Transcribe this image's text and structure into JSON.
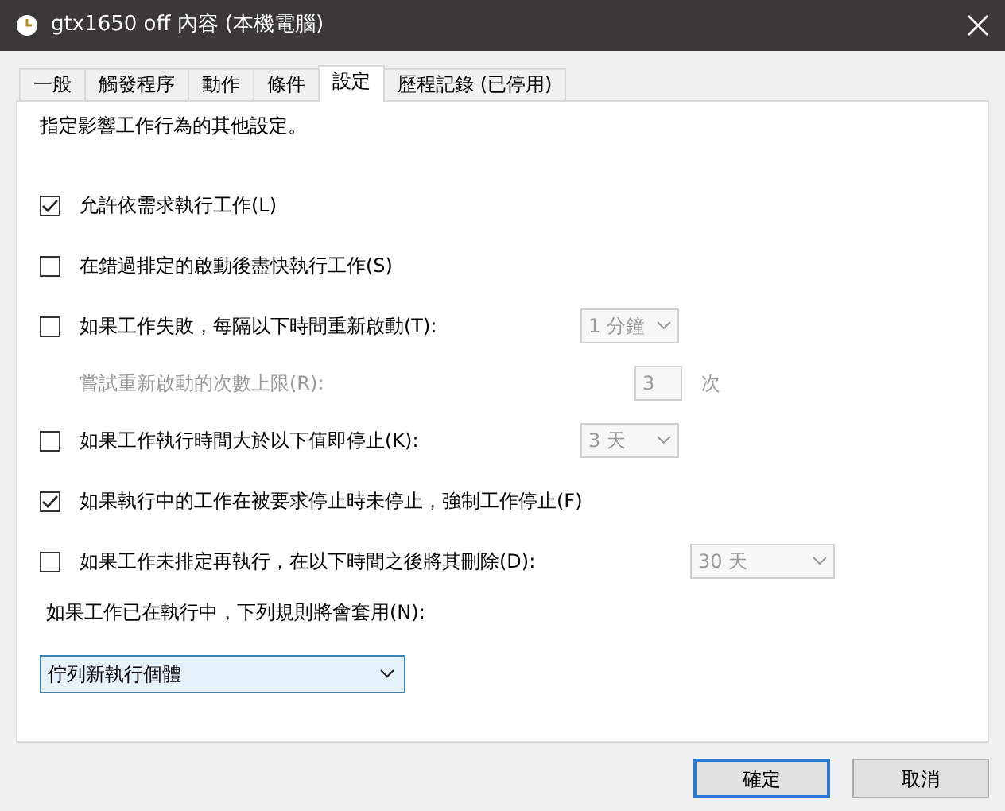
{
  "window": {
    "title": "gtx1650 off 內容 (本機電腦)"
  },
  "tabs": [
    {
      "label": "一般",
      "selected": false
    },
    {
      "label": "觸發程序",
      "selected": false
    },
    {
      "label": "動作",
      "selected": false
    },
    {
      "label": "條件",
      "selected": false
    },
    {
      "label": "設定",
      "selected": true
    },
    {
      "label": "歷程記錄 (已停用)",
      "selected": false
    }
  ],
  "description": "指定影響工作行為的其他設定。",
  "options": [
    {
      "kind": "checkbox",
      "label": "允許依需求執行工作(L)",
      "checked": true
    },
    {
      "kind": "checkbox",
      "label": "在錯過排定的啟動後盡快執行工作(S)",
      "checked": false
    },
    {
      "kind": "checkbox",
      "label": "如果工作失敗，每隔以下時間重新啟動(T):",
      "checked": false,
      "control": {
        "kind": "short-select",
        "value": "1 分鐘",
        "disabled": true
      }
    },
    {
      "kind": "sub",
      "label": "嘗試重新啟動的次數上限(R):",
      "disabled": true,
      "control": {
        "kind": "number",
        "value": "3",
        "unit": "次",
        "disabled": true
      }
    },
    {
      "kind": "checkbox",
      "label": "如果工作執行時間大於以下值即停止(K):",
      "checked": false,
      "control": {
        "kind": "short-select",
        "value": "3 天",
        "disabled": true
      }
    },
    {
      "kind": "checkbox",
      "label": "如果執行中的工作在被要求停止時未停止，強制工作停止(F)",
      "checked": true
    },
    {
      "kind": "checkbox",
      "label": "如果工作未排定再執行，在以下時間之後將其刪除(D):",
      "checked": false,
      "control": {
        "kind": "wide-select",
        "value": "30 天",
        "disabled": true
      }
    }
  ],
  "rule": {
    "label": "如果工作已在執行中，下列規則將會套用(N):",
    "value": "佇列新執行個體"
  },
  "buttons": [
    "確定",
    "取消"
  ]
}
